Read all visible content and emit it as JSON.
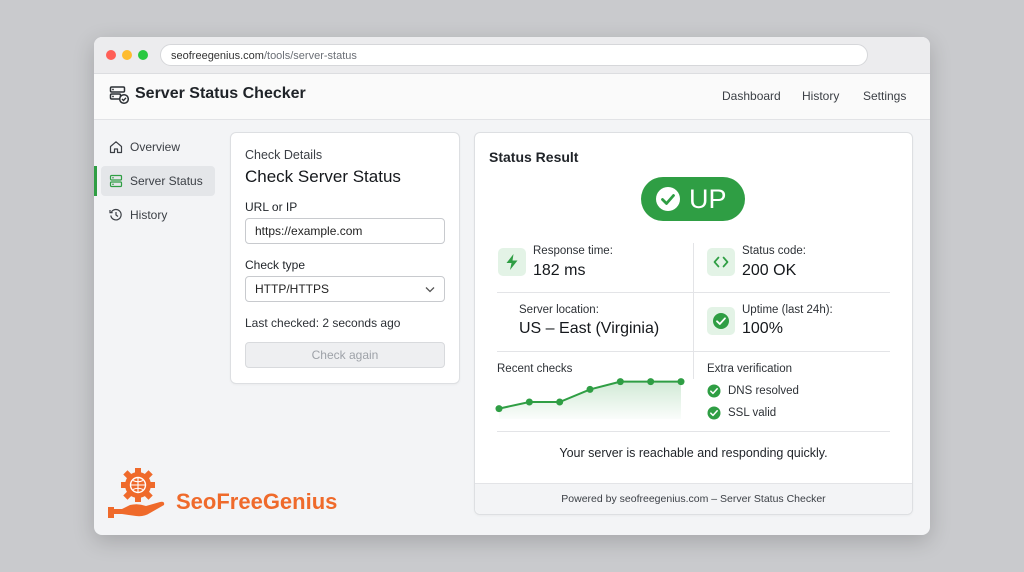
{
  "browser": {
    "url_domain": "seofreegenius.com",
    "url_path": "/tools/server-status"
  },
  "header": {
    "title": "Server Status Checker",
    "nav": [
      "Dashboard",
      "History",
      "Settings"
    ]
  },
  "sidebar": {
    "items": [
      {
        "label": "Overview",
        "icon": "home-icon"
      },
      {
        "label": "Server Status",
        "icon": "server-icon",
        "active": true
      },
      {
        "label": "History",
        "icon": "history-icon"
      }
    ]
  },
  "check_form": {
    "section_label": "Check Details",
    "heading": "Check Server Status",
    "url_label": "URL or IP",
    "url_value": "https://example.com",
    "type_label": "Check type",
    "type_value": "HTTP/HTTPS",
    "last_checked": "Last checked: 2 seconds ago",
    "button_label": "Check again"
  },
  "result": {
    "title": "Status Result",
    "status": "UP",
    "metrics": {
      "response_label": "Response time:",
      "response_value": "182 ms",
      "code_label": "Status code:",
      "code_value": "200 OK",
      "location_label": "Server location:",
      "location_value": "US – East (Virginia)",
      "uptime_label": "Uptime (last 24h):",
      "uptime_value": "100%"
    },
    "recent_checks_label": "Recent checks",
    "recent_checks": [
      0.08,
      0.3,
      0.3,
      0.72,
      0.98,
      0.98,
      0.98
    ],
    "extra_label": "Extra verification",
    "extra_items": [
      "DNS resolved",
      "SSL valid"
    ],
    "summary": "Your server is reachable and responding quickly.",
    "footer": "Powered by seofreegenius.com – Server Status Checker"
  },
  "brand": {
    "name": "SeoFreeGenius"
  },
  "colors": {
    "accent_green": "#2f9e44",
    "brand_orange": "#ef6a2b"
  }
}
